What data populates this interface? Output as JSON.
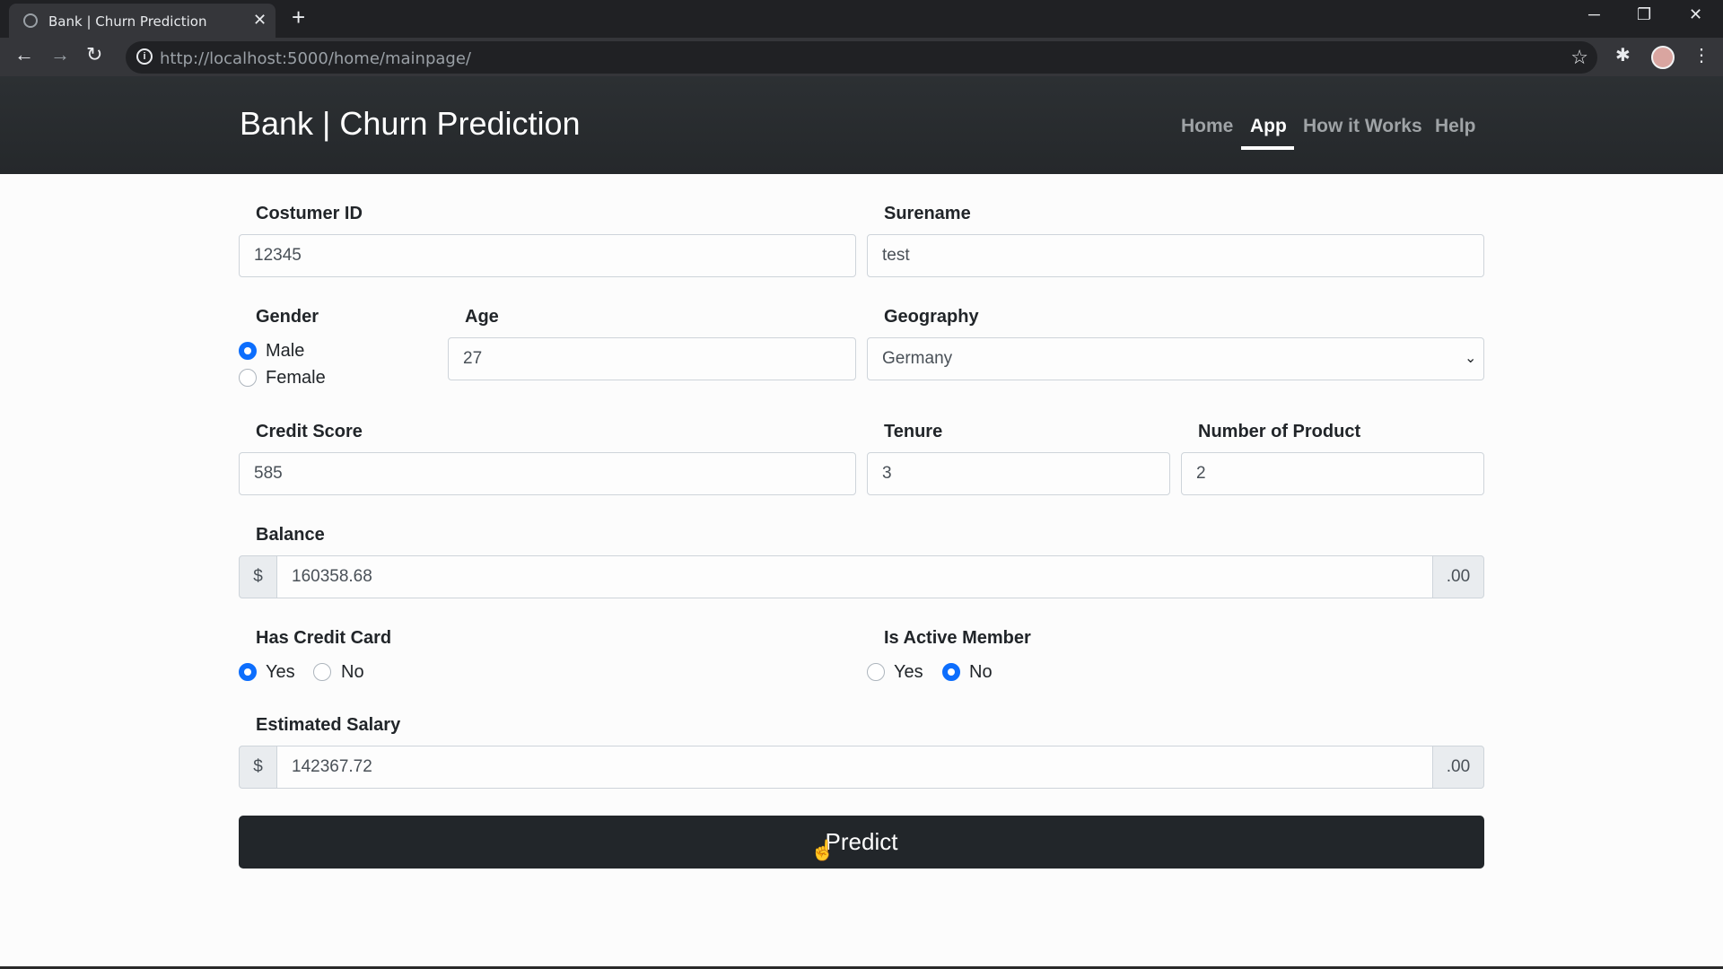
{
  "browser": {
    "tab_title": "Bank | Churn Prediction",
    "url": "http://localhost:5000/home/mainpage/",
    "new_tab": "+"
  },
  "navbar": {
    "brand": "Bank | Churn Prediction",
    "links": [
      "Home",
      "App",
      "How it Works",
      "Help"
    ],
    "active": "App"
  },
  "form": {
    "customer_id": {
      "label": "Costumer ID",
      "value": "12345"
    },
    "surname": {
      "label": "Surename",
      "value": "test"
    },
    "gender": {
      "label": "Gender",
      "options": [
        "Male",
        "Female"
      ],
      "selected": "Male"
    },
    "age": {
      "label": "Age",
      "value": "27"
    },
    "geography": {
      "label": "Geography",
      "value": "Germany"
    },
    "credit_score": {
      "label": "Credit Score",
      "value": "585"
    },
    "tenure": {
      "label": "Tenure",
      "value": "3"
    },
    "num_products": {
      "label": "Number of Product",
      "value": "2"
    },
    "balance": {
      "label": "Balance",
      "prefix": "$",
      "value": "160358.68",
      "suffix": ".00"
    },
    "has_credit_card": {
      "label": "Has Credit Card",
      "options": [
        "Yes",
        "No"
      ],
      "selected": "Yes"
    },
    "is_active_member": {
      "label": "Is Active Member",
      "options": [
        "Yes",
        "No"
      ],
      "selected": "No"
    },
    "estimated_salary": {
      "label": "Estimated Salary",
      "prefix": "$",
      "value": "142367.72",
      "suffix": ".00"
    },
    "submit_label": "Predict"
  },
  "colors": {
    "accent": "#0d6efd",
    "navbar_bg": "#2c3033",
    "button_bg": "#22262a"
  }
}
